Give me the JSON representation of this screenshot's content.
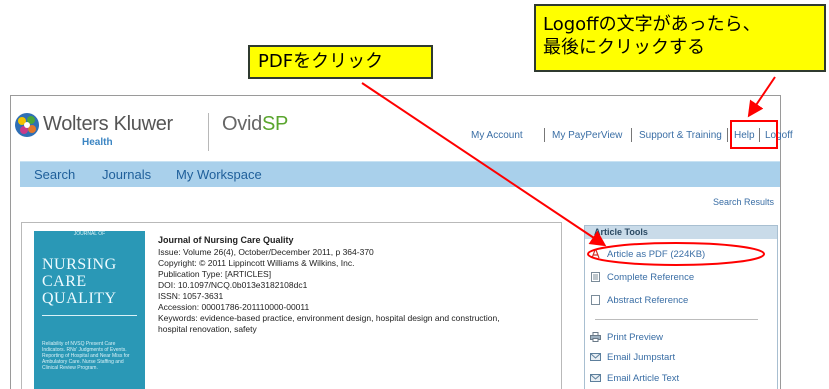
{
  "callouts": {
    "pdf": "PDFをクリック",
    "logoff_line1": "Logoffの文字があったら、",
    "logoff_line2": "最後にクリックする"
  },
  "brand": {
    "company": "Wolters Kluwer",
    "division": "Health",
    "product_main": "Ovid",
    "product_accent": "SP"
  },
  "top_nav": [
    "My Account",
    "My PayPerView",
    "Support & Training",
    "Help",
    "Logoff"
  ],
  "main_nav": [
    "Search",
    "Journals",
    "My Workspace"
  ],
  "search_results_link": "Search Results",
  "cover": {
    "top_text": "JOURNAL OF",
    "title_lines": [
      "NURSING",
      "CARE",
      "QUALITY"
    ],
    "bottom_text": "Reliability of NVSQ Present Care Indicators. RNs' Judgments of Events. Reporting of Hospital and Near Miss for Ambulatory Care. Nurse Staffing and Clinical Review Program."
  },
  "article": {
    "journal": "Journal of Nursing Care Quality",
    "issue": "Issue: Volume 26(4), October/December 2011, p 364-370",
    "copyright": "Copyright: © 2011 Lippincott Williams & Wilkins, Inc.",
    "publication_type": "Publication Type: [ARTICLES]",
    "doi": "DOI: 10.1097/NCQ.0b013e3182108dc1",
    "issn": "ISSN: 1057-3631",
    "accession": "Accession: 00001786-201110000-00011",
    "keywords_line1": "Keywords: evidence-based practice, environment design, hospital design and construction,",
    "keywords_line2": "hospital renovation, safety"
  },
  "article_tools": {
    "header": "Article Tools",
    "article_as_pdf": "Article as PDF",
    "pdf_size": "(224KB)",
    "complete_reference": "Complete Reference",
    "abstract_reference": "Abstract Reference",
    "print_preview": "Print Preview",
    "email_jumpstart": "Email Jumpstart",
    "email_article_text": "Email Article Text"
  },
  "colors": {
    "callout_yellow": "#ffff00",
    "annotation_red": "#ff0000",
    "nav_bar_blue": "#a9d0eb",
    "link_blue": "#3a6ea5",
    "cover_teal": "#2a98b6"
  }
}
